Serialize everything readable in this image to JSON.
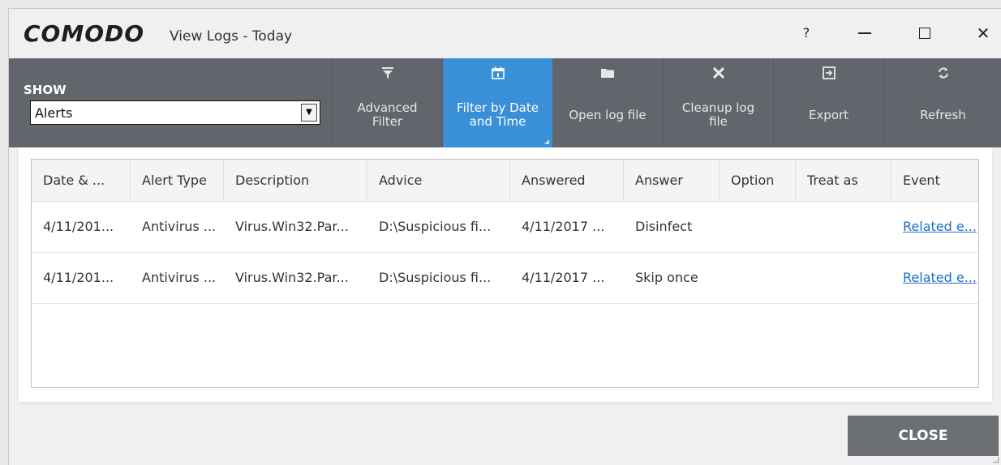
{
  "window": {
    "brand": "COMODO",
    "title": "View Logs - Today",
    "help": "?",
    "close_glyph": "✕"
  },
  "toolbar": {
    "show_label": "SHOW",
    "show_value": "Alerts",
    "buttons": [
      {
        "label_1": "Advanced",
        "label_2": "Filter",
        "icon": "filter-icon"
      },
      {
        "label_1": "Filter by Date",
        "label_2": "and Time",
        "icon": "calendar-icon",
        "active": true
      },
      {
        "label_1": "Open log file",
        "icon": "folder-icon"
      },
      {
        "label_1": "Cleanup log",
        "label_2": "file",
        "icon": "close-x-icon"
      },
      {
        "label_1": "Export",
        "icon": "export-icon"
      },
      {
        "label_1": "Refresh",
        "icon": "refresh-icon"
      }
    ]
  },
  "table": {
    "columns": [
      "Date & ...",
      "Alert Type",
      "Description",
      "Advice",
      "Answered",
      "Answer",
      "Option",
      "Treat as",
      "Event"
    ],
    "rows": [
      {
        "date": "4/11/201...",
        "alert_type": "Antivirus ...",
        "description": "Virus.Win32.Par...",
        "advice": "D:\\Suspicious fi...",
        "answered": "4/11/2017 ...",
        "answer": "Disinfect",
        "option": "",
        "treat_as": "",
        "event": "Related e..."
      },
      {
        "date": "4/11/201...",
        "alert_type": "Antivirus ...",
        "description": "Virus.Win32.Par...",
        "advice": "D:\\Suspicious fi...",
        "answered": "4/11/2017 ...",
        "answer": "Skip once",
        "option": "",
        "treat_as": "",
        "event": "Related e..."
      }
    ]
  },
  "footer": {
    "close_label": "CLOSE"
  },
  "colors": {
    "toolbar_bg": "#62656b",
    "active_button": "#3a8fd9",
    "close_button": "#6b6e73",
    "link": "#1a6fc6"
  }
}
